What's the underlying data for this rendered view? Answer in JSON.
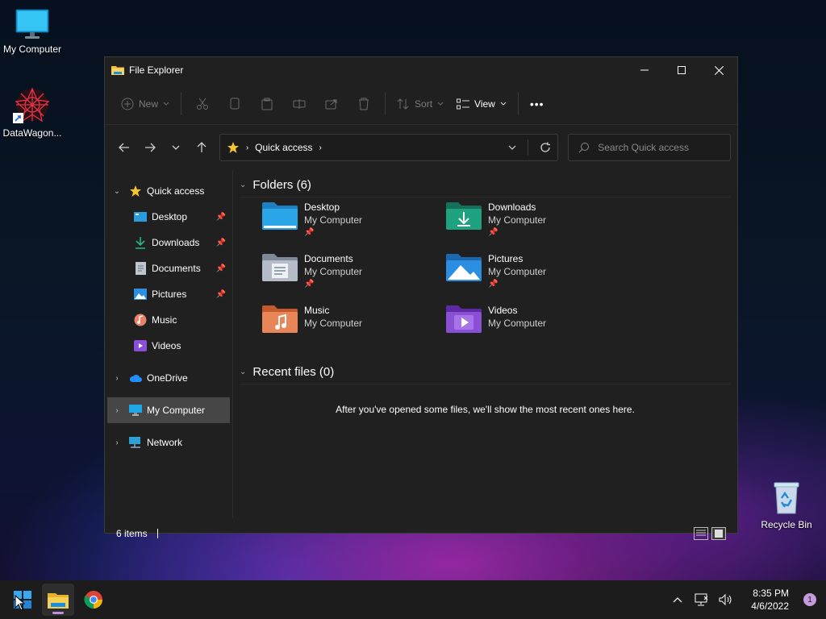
{
  "desktop": {
    "icons": [
      {
        "label": "My Computer"
      },
      {
        "label": "DataWagon..."
      },
      {
        "label": "Recycle Bin"
      }
    ]
  },
  "window": {
    "title": "File Explorer",
    "toolbar": {
      "new_label": "New",
      "sort_label": "Sort",
      "view_label": "View",
      "more_label": "•••"
    },
    "address": {
      "crumb": "Quick access"
    },
    "search": {
      "placeholder": "Search Quick access"
    },
    "navpane": {
      "quick_access": "Quick access",
      "items": [
        {
          "label": "Desktop",
          "pinned": true
        },
        {
          "label": "Downloads",
          "pinned": true
        },
        {
          "label": "Documents",
          "pinned": true
        },
        {
          "label": "Pictures",
          "pinned": true
        },
        {
          "label": "Music",
          "pinned": false
        },
        {
          "label": "Videos",
          "pinned": false
        }
      ],
      "onedrive": "OneDrive",
      "mycomputer": "My Computer",
      "network": "Network"
    },
    "folders_header": "Folders (6)",
    "folders": [
      {
        "name": "Desktop",
        "location": "My Computer",
        "pinned": true,
        "color": "#2a9bdc"
      },
      {
        "name": "Downloads",
        "location": "My Computer",
        "pinned": true,
        "color": "#1d9a7a"
      },
      {
        "name": "Documents",
        "location": "My Computer",
        "pinned": true,
        "color": "#9aa6b6"
      },
      {
        "name": "Pictures",
        "location": "My Computer",
        "pinned": true,
        "color": "#2c8ee0"
      },
      {
        "name": "Music",
        "location": "My Computer",
        "pinned": false,
        "color": "#e07a4a"
      },
      {
        "name": "Videos",
        "location": "My Computer",
        "pinned": false,
        "color": "#8b4fd6"
      }
    ],
    "recent_header": "Recent files (0)",
    "recent_message": "After you've opened some files, we'll show the most recent ones here.",
    "status": {
      "items": "6 items"
    }
  },
  "taskbar": {
    "time": "8:35 PM",
    "date": "4/6/2022",
    "notifications": "1"
  }
}
